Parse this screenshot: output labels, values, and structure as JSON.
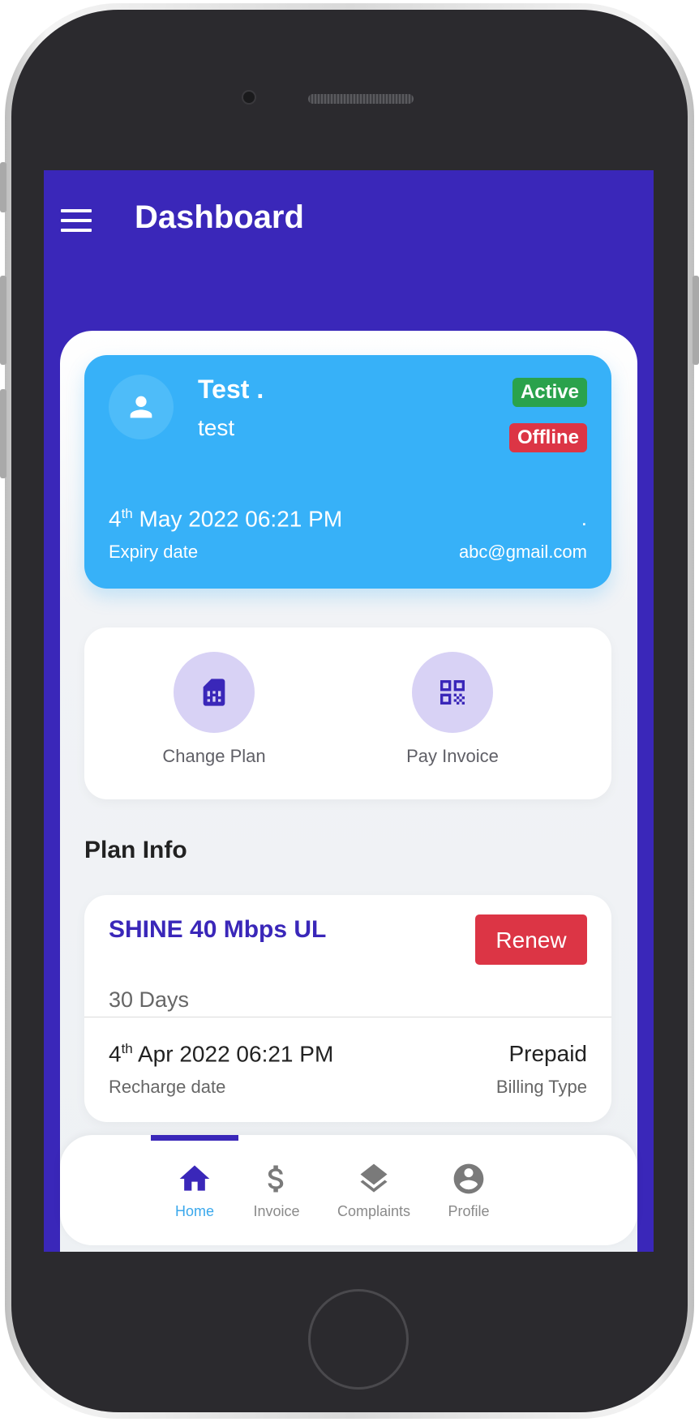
{
  "header": {
    "title": "Dashboard",
    "menu_icon": "hamburger-menu-icon"
  },
  "profile": {
    "avatar_icon": "person-icon",
    "name": "Test .",
    "username": "test",
    "status_badge": "Active",
    "connection_badge": "Offline",
    "expiry": {
      "day": "4",
      "suffix": "th",
      "rest": " May 2022 06:21 PM",
      "label": "Expiry date"
    },
    "dot": ".",
    "email": "abc@gmail.com"
  },
  "actions": [
    {
      "label": "Change Plan",
      "icon": "sim-card-icon"
    },
    {
      "label": "Pay Invoice",
      "icon": "qr-code-icon"
    }
  ],
  "plan_info": {
    "section_title": "Plan Info",
    "plan_name": "SHINE 40 Mbps UL",
    "renew_label": "Renew",
    "duration": "30 Days",
    "recharge": {
      "day": "4",
      "suffix": "th",
      "rest": " Apr 2022 06:21 PM",
      "label": "Recharge date"
    },
    "billing": {
      "value": "Prepaid",
      "label": "Billing Type"
    }
  },
  "bottom_nav": [
    {
      "label": "Home",
      "icon": "home-icon",
      "active": true
    },
    {
      "label": "Invoice",
      "icon": "dollar-icon",
      "active": false
    },
    {
      "label": "Complaints",
      "icon": "layers-icon",
      "active": false
    },
    {
      "label": "Profile",
      "icon": "account-circle-icon",
      "active": false
    }
  ],
  "colors": {
    "primary": "#3a27b9",
    "card_blue": "#37b1f8",
    "active_green": "#2aa24c",
    "danger_red": "#dc3545",
    "nav_active": "#3aa8ec",
    "action_bg": "#d8d2f5"
  }
}
